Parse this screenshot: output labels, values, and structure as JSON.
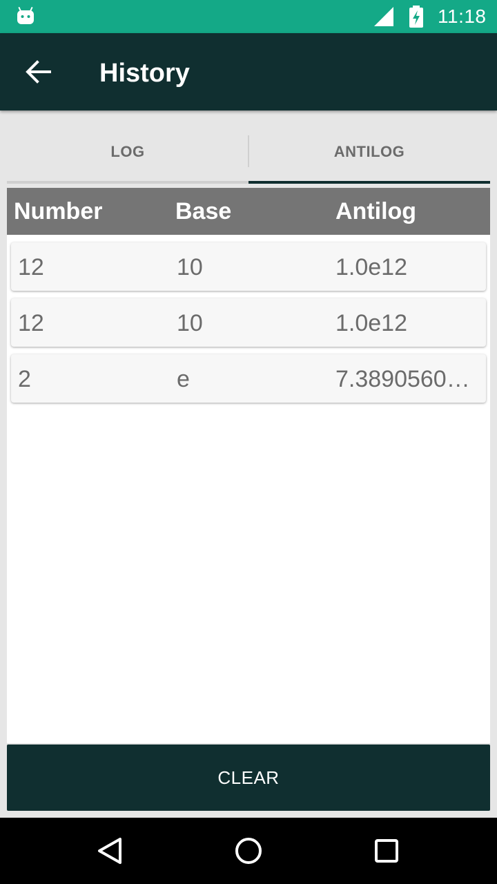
{
  "status_bar": {
    "time": "11:18",
    "icons": [
      "android-icon",
      "signal-icon",
      "battery-charging-icon"
    ],
    "color": "#14a987"
  },
  "app_bar": {
    "title": "History",
    "back_icon": "arrow-back-icon",
    "color": "#102f30"
  },
  "tabs": [
    {
      "label": "LOG",
      "selected": false
    },
    {
      "label": "ANTILOG",
      "selected": true
    }
  ],
  "table": {
    "headers": [
      "Number",
      "Base",
      "Antilog"
    ],
    "rows": [
      {
        "number": "12",
        "base": "10",
        "antilog": "1.0e12"
      },
      {
        "number": "12",
        "base": "10",
        "antilog": "1.0e12"
      },
      {
        "number": "2",
        "base": "e",
        "antilog": "7.3890560…"
      }
    ]
  },
  "clear_button": {
    "label": "CLEAR"
  },
  "nav_bar": {
    "icons": [
      "nav-back-icon",
      "nav-home-icon",
      "nav-recents-icon"
    ]
  }
}
